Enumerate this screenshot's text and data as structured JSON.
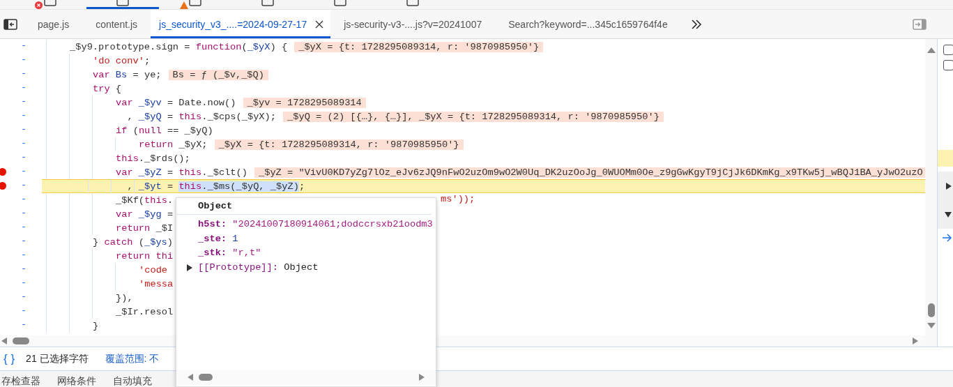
{
  "top_tabs": [
    {
      "selected": false,
      "error": true,
      "warning": false
    },
    {
      "selected": true,
      "error": false,
      "warning": false
    },
    {
      "selected": false,
      "error": false,
      "warning": true
    },
    {
      "selected": false,
      "error": false,
      "warning": false
    },
    {
      "selected": false,
      "error": false,
      "warning": false
    },
    {
      "selected": false,
      "error": false,
      "warning": false
    }
  ],
  "file_tabs": [
    {
      "label": "page.js",
      "selected": false
    },
    {
      "label": "content.js",
      "selected": false
    },
    {
      "label": "js_security_v3_....=2024-09-27-17",
      "selected": true
    },
    {
      "label": "js-security-v3-....js?v=20241007",
      "selected": false
    },
    {
      "label": "Search?keyword=...345c1659764f4e",
      "selected": false
    }
  ],
  "code": [
    {
      "marker": "-",
      "seg": [
        {
          "kind": "plain",
          "text": "_$y9.prototype.sign = "
        },
        {
          "kind": "kw",
          "text": "function"
        },
        {
          "kind": "plain",
          "text": "("
        },
        {
          "kind": "var",
          "text": "_$yX"
        },
        {
          "kind": "plain",
          "text": ") {"
        }
      ],
      "value": "_$yX = {t: 1728295089314, r: '9870985950'}",
      "breakpoint": false,
      "paused": false,
      "children": [
        {
          "marker": "-",
          "seg": [
            {
              "kind": "str",
              "text": "'do conv'"
            },
            {
              "kind": "plain",
              "text": ";"
            }
          ],
          "breakpoint": false,
          "paused": false
        },
        {
          "marker": "-",
          "seg": [
            {
              "kind": "kw",
              "text": "var "
            },
            {
              "kind": "var",
              "text": "Bs"
            },
            {
              "kind": "plain",
              "text": " = ye;"
            }
          ],
          "value": "Bs = ƒ (_$v,_$Q)",
          "breakpoint": false,
          "paused": false
        },
        {
          "marker": "-",
          "seg": [
            {
              "kind": "kw",
              "text": "try"
            },
            {
              "kind": "plain",
              "text": " {"
            }
          ],
          "breakpoint": false,
          "paused": false,
          "children": [
            {
              "marker": "-",
              "seg": [
                {
                  "kind": "kw",
                  "text": "var "
                },
                {
                  "kind": "var",
                  "text": "_$yv"
                },
                {
                  "kind": "plain",
                  "text": " = Date.now()"
                }
              ],
              "value": "_$yv = 1728295089314",
              "breakpoint": false,
              "paused": false
            },
            {
              "marker": "-",
              "seg": [
                {
                  "kind": "plain",
                  "text": "  , "
                },
                {
                  "kind": "var",
                  "text": "_$yQ"
                },
                {
                  "kind": "plain",
                  "text": " = "
                },
                {
                  "kind": "kw",
                  "text": "this"
                },
                {
                  "kind": "plain",
                  "text": "._$cps(_$yX);"
                }
              ],
              "value": "_$yQ = (2) [{…}, {…}], _$yX = {t: 1728295089314, r: '9870985950'}",
              "breakpoint": false,
              "paused": false
            },
            {
              "marker": "-",
              "seg": [
                {
                  "kind": "kw",
                  "text": "if"
                },
                {
                  "kind": "plain",
                  "text": " ("
                },
                {
                  "kind": "kw",
                  "text": "null"
                },
                {
                  "kind": "plain",
                  "text": " == _$yQ)"
                }
              ],
              "breakpoint": false,
              "paused": false,
              "children": [
                {
                  "marker": "-",
                  "seg": [
                    {
                      "kind": "kw",
                      "text": "return"
                    },
                    {
                      "kind": "plain",
                      "text": " _$yX;"
                    }
                  ],
                  "value": "_$yX = {t: 1728295089314, r: '9870985950'}",
                  "breakpoint": false,
                  "paused": false
                }
              ]
            },
            {
              "marker": "-",
              "seg": [
                {
                  "kind": "kw",
                  "text": "this"
                },
                {
                  "kind": "plain",
                  "text": "._$rds();"
                }
              ],
              "breakpoint": false,
              "paused": false
            },
            {
              "marker": "-",
              "seg": [
                {
                  "kind": "kw",
                  "text": "var "
                },
                {
                  "kind": "var",
                  "text": "_$yZ"
                },
                {
                  "kind": "plain",
                  "text": " = "
                },
                {
                  "kind": "kw",
                  "text": "this"
                },
                {
                  "kind": "plain",
                  "text": "._$clt()"
                }
              ],
              "value": "_$yZ = \"VivU0KD7yZg7lOz_eJv6zJQ9nFwO2uzOm9wO2W0Uq_DK2uzOoJg_0WUOMm0Oe_z9gGwKgyT9jCjJk6DKmKg_x9TKw5j_wBQJ1BA_yJwO2uzO",
              "breakpoint": true,
              "paused": false
            },
            {
              "marker": "-",
              "seg": [
                {
                  "kind": "plain",
                  "text": "  , "
                },
                {
                  "kind": "var",
                  "text": "_$yt"
                },
                {
                  "kind": "plain",
                  "text": " = "
                },
                {
                  "kind": "kwsel",
                  "text": "this"
                },
                {
                  "kind": "sel",
                  "text": "._$ms(_$yQ, _$yZ)"
                },
                {
                  "kind": "plain",
                  "text": ";"
                }
              ],
              "breakpoint": true,
              "paused": true
            },
            {
              "marker": "-",
              "seg": [
                {
                  "kind": "plain",
                  "text": "_$Kf("
                },
                {
                  "kind": "kw",
                  "text": "this"
                },
                {
                  "kind": "plain",
                  "text": "."
                },
                {
                  "kind": "after",
                  "text": "ms'));"
                }
              ],
              "breakpoint": false,
              "paused": false
            },
            {
              "marker": "-",
              "seg": [
                {
                  "kind": "kw",
                  "text": "var "
                },
                {
                  "kind": "var",
                  "text": "_$yg"
                },
                {
                  "kind": "plain",
                  "text": " ="
                }
              ],
              "breakpoint": false,
              "paused": false
            },
            {
              "marker": "-",
              "seg": [
                {
                  "kind": "kw",
                  "text": "return"
                },
                {
                  "kind": "plain",
                  "text": " _$I"
                }
              ],
              "breakpoint": false,
              "paused": false
            }
          ]
        },
        {
          "marker": "-",
          "seg": [
            {
              "kind": "plain",
              "text": "} "
            },
            {
              "kind": "kw",
              "text": "catch"
            },
            {
              "kind": "plain",
              "text": " ("
            },
            {
              "kind": "var",
              "text": "_$ys"
            },
            {
              "kind": "plain",
              "text": ")"
            }
          ],
          "breakpoint": false,
          "paused": false,
          "children": [
            {
              "marker": "-",
              "seg": [
                {
                  "kind": "kw",
                  "text": "return thi"
                }
              ],
              "breakpoint": false,
              "paused": false,
              "children": [
                {
                  "marker": "-",
                  "seg": [
                    {
                      "kind": "str",
                      "text": "'code"
                    }
                  ],
                  "breakpoint": false,
                  "paused": false
                },
                {
                  "marker": "-",
                  "seg": [
                    {
                      "kind": "str",
                      "text": "'messa"
                    }
                  ],
                  "breakpoint": false,
                  "paused": false
                }
              ]
            },
            {
              "marker": "-",
              "seg": [
                {
                  "kind": "plain",
                  "text": "}),"
                }
              ],
              "breakpoint": false,
              "paused": false
            },
            {
              "marker": "-",
              "seg": [
                {
                  "kind": "plain",
                  "text": "_$Ir.resol"
                }
              ],
              "breakpoint": false,
              "paused": false
            }
          ]
        },
        {
          "marker": "-",
          "seg": [
            {
              "kind": "plain",
              "text": "}"
            }
          ],
          "breakpoint": false,
          "paused": false
        }
      ]
    }
  ],
  "popup": {
    "title": "Object",
    "props": [
      {
        "key": "h5st:",
        "kind": "string",
        "value": "\"20241007180914061;dodccrsxb21oodm3"
      },
      {
        "key": "_ste:",
        "kind": "number",
        "value": "1"
      },
      {
        "key": "_stk:",
        "kind": "string",
        "value": "\"r,t\""
      }
    ],
    "prototype": {
      "key": "[[Prototype]]:",
      "value": "Object",
      "expanded": false
    }
  },
  "status": {
    "format_icon": "{ }",
    "selection": "21 已选择字符",
    "coverage": "覆盖范围: 不"
  },
  "drawer_tabs": [
    "存检查器",
    "网络条件",
    "自动填充"
  ],
  "right_panel": {
    "checkboxes": [
      {
        "checked": false
      },
      {
        "checked": false
      }
    ]
  }
}
